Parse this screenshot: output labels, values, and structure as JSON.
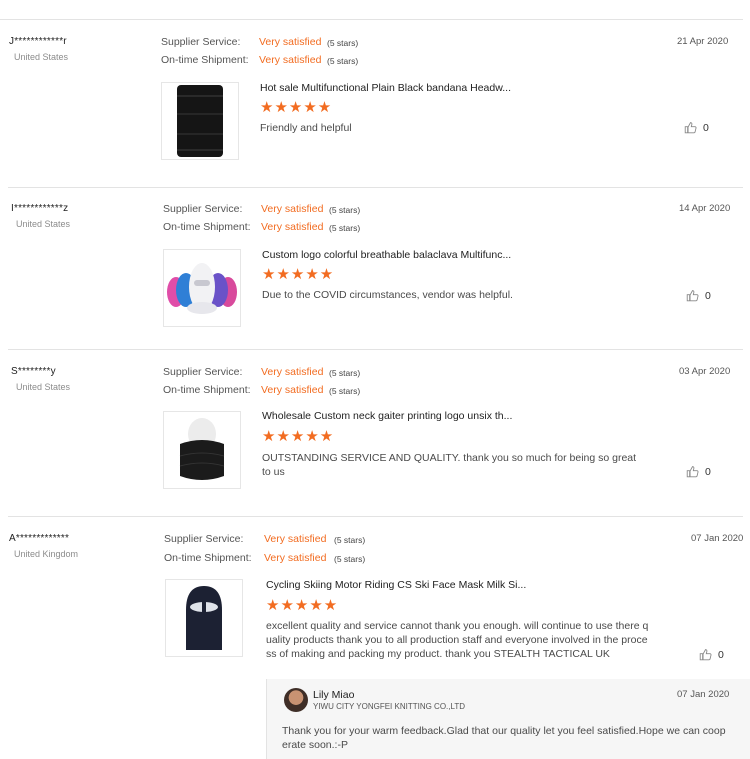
{
  "reviews": [
    {
      "buyer": "J************r",
      "country": "United States",
      "supplier_label": "Supplier Service:",
      "supplier_value": "Very satisfied",
      "supplier_stars": "(5 stars)",
      "shipment_label": "On-time Shipment:",
      "shipment_value": "Very satisfied",
      "shipment_stars": "(5 stars)",
      "date": "21 Apr 2020",
      "product_title": "Hot sale Multifunctional Plain Black bandana Headw...",
      "rating_stars": "★★★★★",
      "rating": 5,
      "comment": "Friendly and helpful",
      "likes": "0"
    },
    {
      "buyer": "I************z",
      "country": "United States",
      "supplier_label": "Supplier Service:",
      "supplier_value": "Very satisfied",
      "supplier_stars": "(5 stars)",
      "shipment_label": "On-time Shipment:",
      "shipment_value": "Very satisfied",
      "shipment_stars": "(5 stars)",
      "date": "14 Apr 2020",
      "product_title": "Custom logo colorful breathable balaclava Multifunc...",
      "rating_stars": "★★★★★",
      "rating": 5,
      "comment": "Due to the COVID circumstances, vendor was helpful.",
      "likes": "0"
    },
    {
      "buyer": "S********y",
      "country": "United States",
      "supplier_label": "Supplier Service:",
      "supplier_value": "Very satisfied",
      "supplier_stars": "(5 stars)",
      "shipment_label": "On-time Shipment:",
      "shipment_value": "Very satisfied",
      "shipment_stars": "(5 stars)",
      "date": "03 Apr 2020",
      "product_title": "Wholesale Custom neck gaiter printing logo unsix th...",
      "rating_stars": "★★★★★",
      "rating": 5,
      "comment": "OUTSTANDING SERVICE AND QUALITY.   thank you so much for being so great to us",
      "likes": "0"
    },
    {
      "buyer": "A*************",
      "country": "United Kingdom",
      "supplier_label": "Supplier Service:",
      "supplier_value": "Very satisfied",
      "supplier_stars": "(5 stars)",
      "shipment_label": "On-time Shipment:",
      "shipment_value": "Very satisfied",
      "shipment_stars": "(5 stars)",
      "date": "07 Jan 2020",
      "product_title": "Cycling Skiing Motor Riding CS Ski Face Mask Milk Si...",
      "rating_stars": "★★★★★",
      "rating": 5,
      "comment": "excellent quality and service cannot thank you enough. will continue to use there q uality products thank you to all production staff and everyone involved in the proce ss of making and packing my product. thank you STEALTH TACTICAL UK",
      "likes": "0",
      "reply": {
        "name": "Lily Miao",
        "company": "YIWU CITY YONGFEI KNITTING CO.,LTD",
        "date": "07 Jan 2020",
        "text": "Thank you for your warm feedback.Glad that our quality let you feel satisfied.Hope we can coop erate soon.:-P"
      }
    }
  ],
  "colors": {
    "accent": "#f26c21",
    "separator": "#e3e3e3",
    "muted": "#8c8c8c"
  },
  "icons": {
    "like": "thumbs-up-icon",
    "rating": "star-icon",
    "avatar": "user-avatar"
  }
}
